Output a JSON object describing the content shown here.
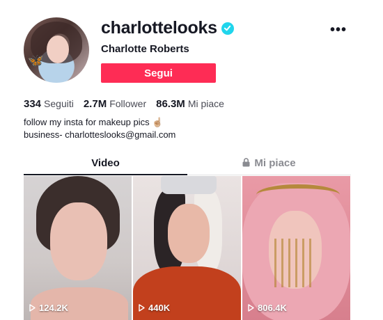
{
  "profile": {
    "username": "charlottelooks",
    "display_name": "Charlotte Roberts",
    "follow_label": "Segui",
    "verified": true
  },
  "stats": [
    {
      "value": "334",
      "label": "Seguiti"
    },
    {
      "value": "2.7M",
      "label": "Follower"
    },
    {
      "value": "86.3M",
      "label": "Mi piace"
    }
  ],
  "bio": {
    "line1": "follow my insta for makeup pics ☝🏼",
    "line2": "business- charlotteslooks@gmail.com"
  },
  "tabs": {
    "video": "Video",
    "likes": "Mi piace"
  },
  "videos": [
    {
      "views": "124.2K"
    },
    {
      "views": "440K"
    },
    {
      "views": "806.4K"
    }
  ],
  "colors": {
    "accent": "#fe2c55",
    "verified": "#20d5ec"
  },
  "icons": [
    "verified-badge-icon",
    "more-options-icon",
    "lock-icon",
    "play-icon"
  ]
}
